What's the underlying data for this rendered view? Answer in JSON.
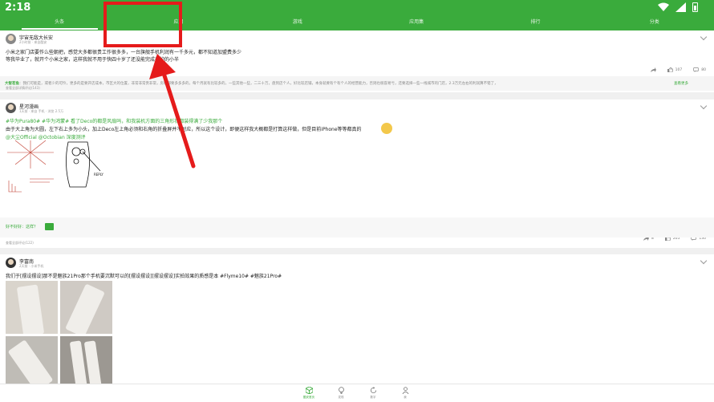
{
  "status": {
    "time": "2:18"
  },
  "tabs": [
    {
      "label": "头条",
      "active": true
    },
    {
      "label": "应用",
      "active": false
    },
    {
      "label": "游戏",
      "active": false
    },
    {
      "label": "应用集",
      "active": false
    },
    {
      "label": "排行",
      "active": false
    },
    {
      "label": "分类",
      "active": false
    }
  ],
  "feed": [
    {
      "author": "宇宙无敌大长安",
      "meta": "2小时前 · 来自酷安",
      "lines": [
        "小米之家门店要作么些朝把，感觉大多都很贵工作很多多，一台旗舰手机利润有一千多元，都不知道加盟费多少",
        "等我毕业了，就开个小米之家，这样我就不用于快四十岁了还没能完成养护的小半"
      ],
      "likes": "107",
      "comments": "80",
      "hot_label": "大智若鱼",
      "hot_text": "：我们可能是，或者少的可怜，更多的是要开店成本，市区大的位置，非常非常贵非常，房租都要多多多的，每个月就有比较多的，一些其他一些，二三十万，盘到店个人，好比较店铺，本身就要有个有个人的经营能力，否则也很容易亏，还要选择一些一线城市的门店，2.3万元左右的利润算不错了，",
      "hot_more": "查看更多",
      "footer": "查看全部详情评论(143)"
    },
    {
      "author": "星河漫画",
      "meta": "1天前 · 来自 手机 · 浏览 2.5万",
      "tag_line": "#华为Pura80# #华为鸿蒙# 看了Deco的都是风扇吗，和我装机方面的三角形状都装得满了少我那个",
      "line2": "由于大上角为大圆，左下右上多为小头，加上Deco左上角必须和右角的折叠屏并不对应，所以这个设计，即便这样我大概都是打算这样做，但是目前iPhone等等都真的",
      "mention": "@大尘Official @Octobian 深度测评",
      "forward": "8",
      "likes": "205",
      "comments": "130",
      "comment_prompt": "好不好好：这样？",
      "footer": "查看全部评论(122)"
    },
    {
      "author": "李富南",
      "meta": "2天前 · 小米手机",
      "text": "我们于[摆设摆设]那不是魅族21Pro那个手机要沉默可以的[摆设摆设][摆设摆设]实拍效果的质感是本 #Flyme10# #魅族21Pro#"
    }
  ],
  "bottom_nav": [
    {
      "label": "酷安首页",
      "icon": "cube-icon",
      "active": true
    },
    {
      "label": "发现",
      "icon": "lightbulb-icon",
      "active": false
    },
    {
      "label": "数字",
      "icon": "refresh-icon",
      "active": false
    },
    {
      "label": "我",
      "icon": "person-icon",
      "active": false
    }
  ],
  "colors": {
    "brand": "#3aab3c",
    "annotation": "#e51b1b"
  }
}
